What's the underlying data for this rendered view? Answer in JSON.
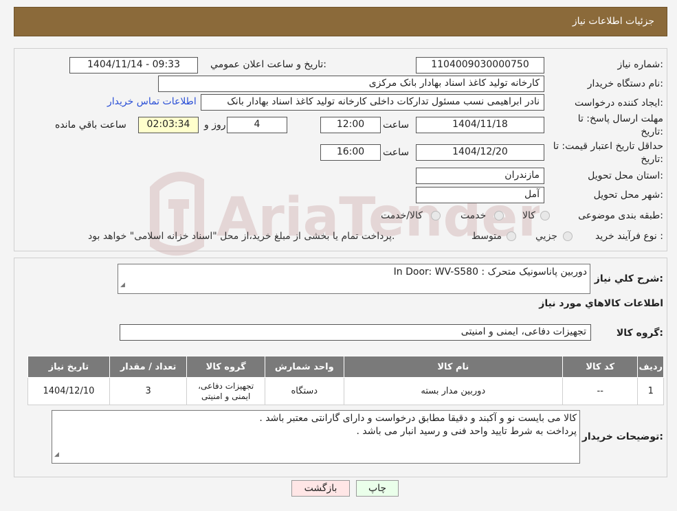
{
  "header": {
    "title": "جزئیات اطلاعات نیاز"
  },
  "form": {
    "need_number_label": "شماره نیاز:",
    "need_number": "1104009030000750",
    "announce_label": "تاریخ و ساعت اعلان عمومي:",
    "announce_value": "1404/11/14 - 09:33",
    "buyer_org_label": "نام دستگاه خریدار:",
    "buyer_org": "کارخانه تولید کاغذ اسناد بهادار بانک مرکزی",
    "creator_label": "ایجاد کننده درخواست:",
    "creator": "نادر ابراهیمی نسب مسئول تدارکات داخلی کارخانه تولید کاغذ اسناد بهادار بانک",
    "contact_link": "اطلاعات تماس خریدار",
    "deadline_label_1": "مهلت ارسال پاسخ: تا",
    "deadline_label_2": "تاریخ:",
    "deadline_date": "1404/11/18",
    "time_label": "ساعت",
    "deadline_time": "12:00",
    "days": "4",
    "days_label": "روز و",
    "remaining_time": "02:03:34",
    "remaining_label": "ساعت باقي مانده",
    "validity_label_1": "حداقل تاریخ اعتبار قیمت: تا",
    "validity_label_2": "تاریخ:",
    "validity_date": "1404/12/20",
    "validity_time": "16:00",
    "province_label": "استان محل تحویل:",
    "province": "مازندران",
    "city_label": "شهر محل تحویل:",
    "city": "آمل",
    "category_label": "طبقه بندی موضوعی:",
    "category_options": [
      "کالا",
      "خدمت",
      "کالا/خدمت"
    ],
    "process_label": "نوع فرآیند خرید :",
    "process_options": [
      "جزیي",
      "متوسط"
    ],
    "process_note": "پرداخت تمام یا بخشی از مبلغ خرید،از محل \"اسناد خزانه اسلامی\" خواهد بود."
  },
  "details": {
    "summary_label": "شرح کلي نياز:",
    "summary": "دوربین پاناسونیک متحرک : In Door: WV-S580",
    "items_title": "اطلاعات کالاهاي مورد نياز",
    "group_label": "گروه کالا:",
    "group": "تجهیزات دفاعی، ایمنی و امنیتی",
    "table": {
      "headers": [
        "رديف",
        "کد کالا",
        "نام کالا",
        "واحد شمارش",
        "گروه کالا",
        "تعداد / مقدار",
        "تاریخ نیاز"
      ],
      "rows": [
        [
          "1",
          "--",
          "دوربین مدار بسته",
          "دستگاه",
          "تجهیزات دفاعی، ایمنی و امنیتی",
          "3",
          "1404/12/10"
        ]
      ]
    },
    "buyer_notes_label": "توضیحات خریدار:",
    "buyer_notes_line1": "کالا می بایست نو و آکبند و دقیقا مطابق درخواست و دارای گارانتی معتبر باشد .",
    "buyer_notes_line2": "پرداخت به شرط تایید واحد فنی و رسید انبار می باشد ."
  },
  "buttons": {
    "print": "چاپ",
    "back": "بازگشت"
  },
  "watermark": {
    "text": "AriaTender.neT"
  },
  "colors": {
    "header": "#8b6a3a",
    "table_header": "#7a7a7a",
    "link": "#2a4fd6",
    "print_btn": "#eaffea",
    "back_btn": "#ffe6e6"
  }
}
